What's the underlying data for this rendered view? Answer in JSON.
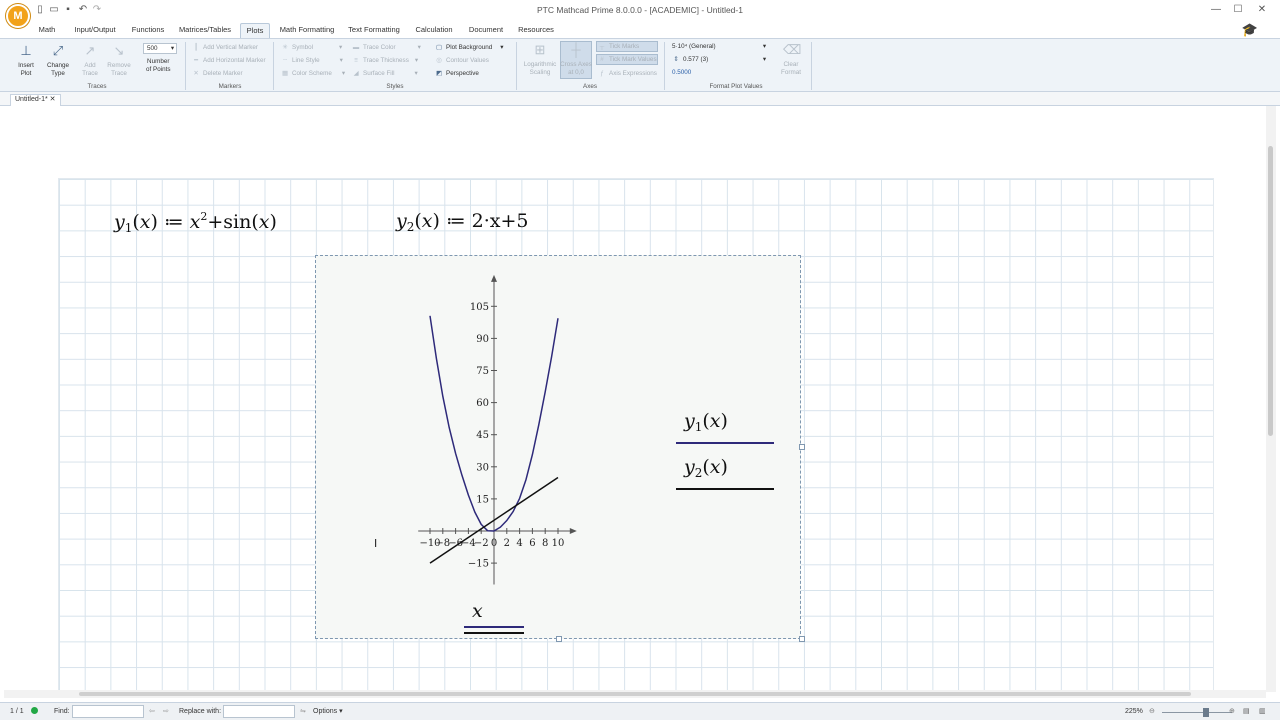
{
  "window": {
    "title": "PTC Mathcad Prime 8.0.0.0 - [ACADEMIC] - Untitled-1",
    "logo": "M"
  },
  "tabs": [
    {
      "label": "Math"
    },
    {
      "label": "Input/Output"
    },
    {
      "label": "Functions"
    },
    {
      "label": "Matrices/Tables"
    },
    {
      "label": "Plots"
    },
    {
      "label": "Math Formatting"
    },
    {
      "label": "Text Formatting"
    },
    {
      "label": "Calculation"
    },
    {
      "label": "Document"
    },
    {
      "label": "Resources"
    }
  ],
  "ribbon": {
    "traces": {
      "group": "Traces",
      "insert_plot": "Insert\nPlot",
      "change_type": "Change\nType",
      "add_trace": "Add\nTrace",
      "remove_trace": "Remove\nTrace",
      "points_value": "500",
      "points_label": "Number\nof Points"
    },
    "markers": {
      "group": "Markers",
      "add_vertical": "Add Vertical Marker",
      "add_horizontal": "Add Horizontal Marker",
      "delete": "Delete Marker"
    },
    "styles": {
      "group": "Styles",
      "symbol": "Symbol",
      "line_style": "Line Style",
      "color_scheme": "Color Scheme",
      "trace_color": "Trace Color",
      "trace_thickness": "Trace Thickness",
      "surface_fill": "Surface Fill",
      "plot_background": "Plot Background",
      "contour_values": "Contour Values",
      "perspective": "Perspective"
    },
    "axes": {
      "group": "Axes",
      "log_scaling": "Logarithmic\nScaling",
      "cross_axes": "Cross Axes\nat 0,0",
      "tick_marks": "Tick Marks",
      "tick_mark_values": "Tick Mark Values",
      "axis_expressions": "Axis Expressions"
    },
    "format": {
      "group": "Format Plot Values",
      "number_format": "5·10⁴ (General)",
      "precision": "0.577 (3)",
      "sample": "0.5000",
      "clear_format": "Clear\nFormat"
    }
  },
  "document": {
    "tab_label": "Untitled-1*"
  },
  "math": {
    "y1_def": {
      "name": "y",
      "sub": "1",
      "arg": "x",
      "rhs_base": "x",
      "rhs_exp": "2",
      "rhs_tail": "+sin",
      "rhs_arg": "x"
    },
    "y2_def": {
      "name": "y",
      "sub": "2",
      "arg": "x",
      "rhs": "2·x+5"
    }
  },
  "plot": {
    "legend": [
      {
        "name": "y",
        "sub": "1",
        "arg": "x",
        "color": "#2e2a7a"
      },
      {
        "name": "y",
        "sub": "2",
        "arg": "x",
        "color": "#111111"
      }
    ],
    "x_axis_label": "x",
    "colors": {
      "y1": "#2e2a7a",
      "y2": "#111111",
      "axis": "#555555"
    }
  },
  "chart_data": {
    "type": "line",
    "x_ticks": [
      -10,
      -8,
      -6,
      -4,
      -2,
      0,
      2,
      4,
      6,
      8,
      10
    ],
    "y_ticks": [
      -15,
      15,
      30,
      45,
      60,
      75,
      90,
      105
    ],
    "xlim": [
      -12,
      12
    ],
    "ylim": [
      -25,
      115
    ],
    "xlabel": "x",
    "series": [
      {
        "name": "y1(x)",
        "expr": "x^2+sin(x)",
        "x": [
          -10,
          -9,
          -8,
          -7,
          -6,
          -5,
          -4,
          -3,
          -2,
          -1,
          0,
          1,
          2,
          3,
          4,
          5,
          6,
          7,
          8,
          9,
          10
        ],
        "values": [
          100.54,
          80.59,
          63.01,
          48.34,
          36.28,
          25.96,
          16.76,
          8.86,
          3.09,
          0.16,
          0,
          1.84,
          4.91,
          9.14,
          15.24,
          24.04,
          35.72,
          49.66,
          64.99,
          81.41,
          99.46
        ]
      },
      {
        "name": "y2(x)",
        "expr": "2·x+5",
        "x": [
          -10,
          10
        ],
        "values": [
          -15,
          25
        ]
      }
    ],
    "grid": false
  },
  "statusbar": {
    "page": "1 / 1",
    "find_label": "Find:",
    "replace_label": "Replace with:",
    "options": "Options",
    "zoom": "225%"
  }
}
